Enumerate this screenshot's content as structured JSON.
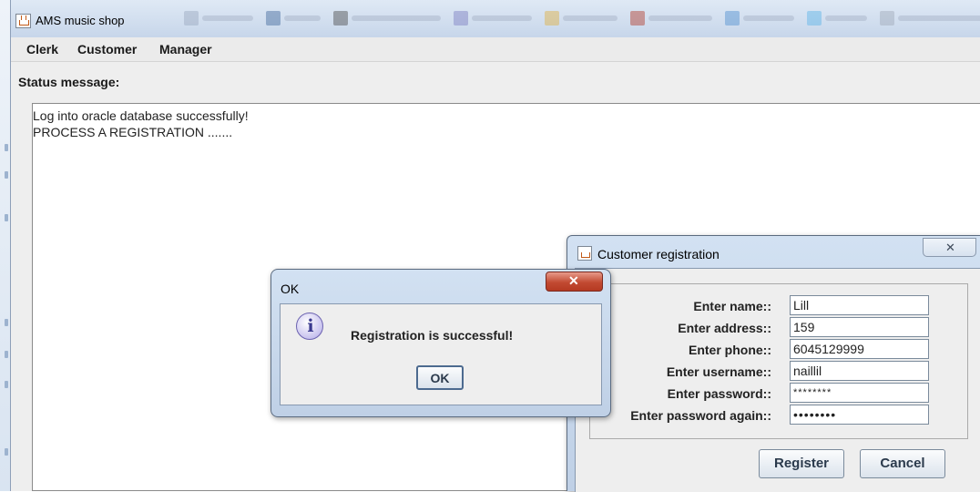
{
  "window": {
    "title": "AMS music shop",
    "background_tabs": [
      {
        "label": "",
        "icon_color": "#9aa8bf"
      },
      {
        "label": "",
        "icon_color": "#41689c"
      },
      {
        "label": "",
        "icon_color": "#4a4a4a"
      },
      {
        "label": "",
        "icon_color": "#7b7cc0"
      },
      {
        "label": "",
        "icon_color": "#e0b040"
      },
      {
        "label": "",
        "icon_color": "#b23a2a"
      },
      {
        "label": "",
        "icon_color": "#4f8fd0"
      },
      {
        "label": "",
        "icon_color": "#5bb4e8"
      },
      {
        "label": "",
        "icon_color": "#9fa9b8"
      },
      {
        "label": "",
        "icon_color": "#b03030"
      }
    ]
  },
  "menu": {
    "items": [
      "Clerk",
      "Customer",
      "Manager"
    ]
  },
  "status": {
    "label": "Status message:",
    "lines": [
      "Log into oracle database successfully!",
      "PROCESS A REGISTRATION ......."
    ]
  },
  "registration_dialog": {
    "title": "Customer registration",
    "close_glyph": "✕",
    "fields": [
      {
        "label": "Enter name::",
        "value": "Lill"
      },
      {
        "label": "Enter address::",
        "value": "159"
      },
      {
        "label": "Enter phone::",
        "value": "6045129999"
      },
      {
        "label": "Enter username::",
        "value": "naillil"
      },
      {
        "label": "Enter password::",
        "value": "********"
      },
      {
        "label": "Enter password again::",
        "value": "••••••••"
      }
    ],
    "register_label": "Register",
    "cancel_label": "Cancel"
  },
  "ok_dialog": {
    "title": "OK",
    "close_glyph": "✕",
    "icon": "info-icon",
    "icon_glyph": "i",
    "message": "Registration is successful!",
    "ok_label": "OK"
  },
  "colors": {
    "title_bar": "#c7d6ea",
    "window_bg": "#eeeeee",
    "close_red": "#c24a32"
  }
}
